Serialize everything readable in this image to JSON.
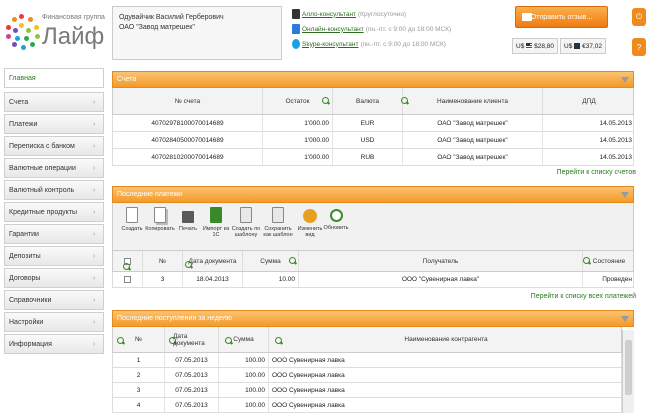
{
  "header": {
    "logo_small": "Финансовая группа",
    "logo_big": "Лайф",
    "user_name": "Одувайчик Василий Герберович",
    "company": "ОАО \"Завод матрешек\"",
    "consultants": [
      {
        "link": "Алло-консультант",
        "note": "(Круглосуточно)",
        "color": "#333333"
      },
      {
        "link": "Онлайн-консультант",
        "note": "(пн.-пт. с 9:00 до 18:00 МСК)",
        "color": "#2f7ad8"
      },
      {
        "link": "Skype-консультант",
        "note": "(пн.-пт. с 9:00 до 18:00 МСК)",
        "color": "#1aa0e6"
      }
    ],
    "feedback_label": "Отправить отзыв...",
    "currency": [
      {
        "code": "U$",
        "value": "$28,80",
        "flag": "us"
      },
      {
        "code": "U$",
        "value": "€37,02",
        "flag": "eu"
      }
    ],
    "side_icons": [
      "power-icon",
      "help-icon"
    ],
    "side_glyphs": [
      "⏻",
      "?"
    ]
  },
  "sidebar": {
    "items": [
      {
        "label": "Главная",
        "active": true
      },
      {
        "label": "Счета"
      },
      {
        "label": "Платежи"
      },
      {
        "label": "Переписка с банком"
      },
      {
        "label": "Валютные операции"
      },
      {
        "label": "Валютный контроль"
      },
      {
        "label": "Кредитные продукты"
      },
      {
        "label": "Гарантии"
      },
      {
        "label": "Депозиты"
      },
      {
        "label": "Договоры"
      },
      {
        "label": "Справочники"
      },
      {
        "label": "Настройки"
      },
      {
        "label": "Информация"
      }
    ]
  },
  "accounts": {
    "title": "Счета",
    "columns": [
      "№ счета",
      "Остаток",
      "Валюта",
      "Наименование клиента",
      "ДПД"
    ],
    "rows": [
      [
        "40702978100070014689",
        "1'000.00",
        "EUR",
        "ОАО \"Завод матрешек\"",
        "14.05.2013"
      ],
      [
        "40702840500070014689",
        "1'000.00",
        "USD",
        "ОАО \"Завод матрешек\"",
        "14.05.2013"
      ],
      [
        "40702810200070014689",
        "1'000.00",
        "RUB",
        "ОАО \"Завод матрешек\"",
        "14.05.2013"
      ]
    ],
    "link": "Перейти к списку счетов"
  },
  "payments": {
    "title": "Последние платежи",
    "toolbar": [
      {
        "label": "Создать",
        "icon": "document-icon",
        "color": "#ffffff"
      },
      {
        "label": "Копировать",
        "icon": "copy-icon",
        "color": "#ffffff"
      },
      {
        "label": "Печать",
        "icon": "printer-icon",
        "color": "#5a5a5a"
      },
      {
        "label": "Импорт из 1С",
        "icon": "import-icon",
        "color": "#3a8a2a"
      },
      {
        "label": "Создать по шаблону",
        "icon": "template-icon",
        "color": "#e8e8e8"
      },
      {
        "label": "Сохранить как шаблон",
        "icon": "save-template-icon",
        "color": "#e8e8e8"
      },
      {
        "label": "Изменить вид",
        "icon": "settings-icon",
        "color": "#e8a020"
      },
      {
        "label": "Обновить",
        "icon": "refresh-icon",
        "color": "#3a8a2a"
      }
    ],
    "columns": [
      "№",
      "Дата документа",
      "Сумма",
      "Получатель",
      "Состояние"
    ],
    "rows": [
      [
        "3",
        "18.04.2013",
        "10.00",
        "ООО \"Сувенирная лавка\"",
        "Проведен"
      ]
    ],
    "link": "Перейти к списку всех платежей"
  },
  "incoming": {
    "title": "Последние поступления за неделю",
    "columns": [
      "№",
      "Дата документа",
      "Сумма",
      "Наименование контрагента"
    ],
    "rows": [
      [
        "1",
        "07.05.2013",
        "100.00",
        "ООО Сувенирная лавка"
      ],
      [
        "2",
        "07.05.2013",
        "100.00",
        "ООО Сувенирная лавка"
      ],
      [
        "3",
        "07.05.2013",
        "100.00",
        "ООО Сувенирная лавка"
      ],
      [
        "4",
        "07.05.2013",
        "100.00",
        "ООО Сувенирная лавка"
      ]
    ]
  }
}
